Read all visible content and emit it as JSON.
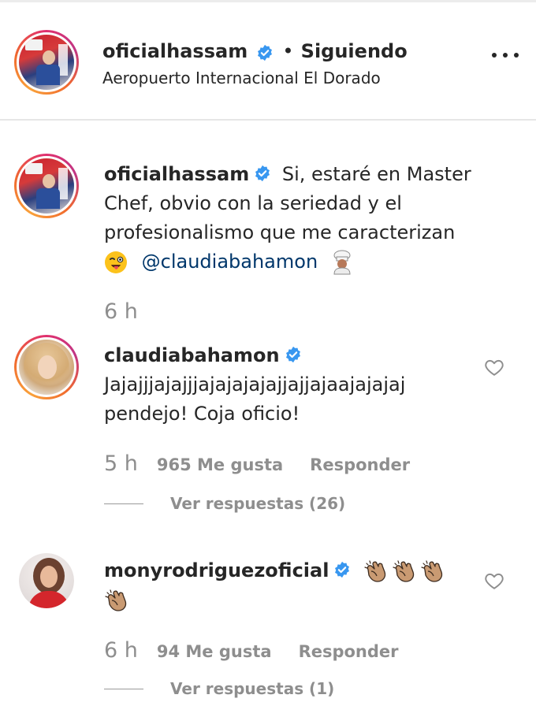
{
  "header": {
    "username": "oficialhassam",
    "separator": "•",
    "follow_status": "Siguiendo",
    "location": "Aeropuerto Internacional El Dorado"
  },
  "comments": [
    {
      "username": "oficialhassam",
      "text_line1": "Si, estaré en Master",
      "text_line2": "Chef, obvio con la seriedad y el",
      "text_line3": "profesionalismo que me caracterizan",
      "mention": "@claudiabahamon",
      "time": "6 h"
    },
    {
      "username": "claudiabahamon",
      "text_line1": "Jajajjjajajjjajajajajajjajjajaajajajaj",
      "text_line2": "pendejo! Coja oficio!",
      "time": "5 h",
      "likes": "965 Me gusta",
      "reply": "Responder",
      "view_replies": "Ver respuestas (26)"
    },
    {
      "username": "monyrodriguezoficial",
      "time": "6 h",
      "likes": "94 Me gusta",
      "reply": "Responder",
      "view_replies": "Ver respuestas (1)"
    }
  ],
  "icons": {
    "verified": "verified-badge-icon",
    "more": "more-options-icon",
    "heart": "heart-outline-icon",
    "emoji_wink": "winking-face-tongue-emoji",
    "emoji_chef": "cook-emoji",
    "emoji_clap": "clapping-hands-emoji"
  },
  "colors": {
    "verified_blue": "#3897f0",
    "mention_blue": "#00376b",
    "muted_gray": "#8e8e8e",
    "text": "#262626"
  }
}
